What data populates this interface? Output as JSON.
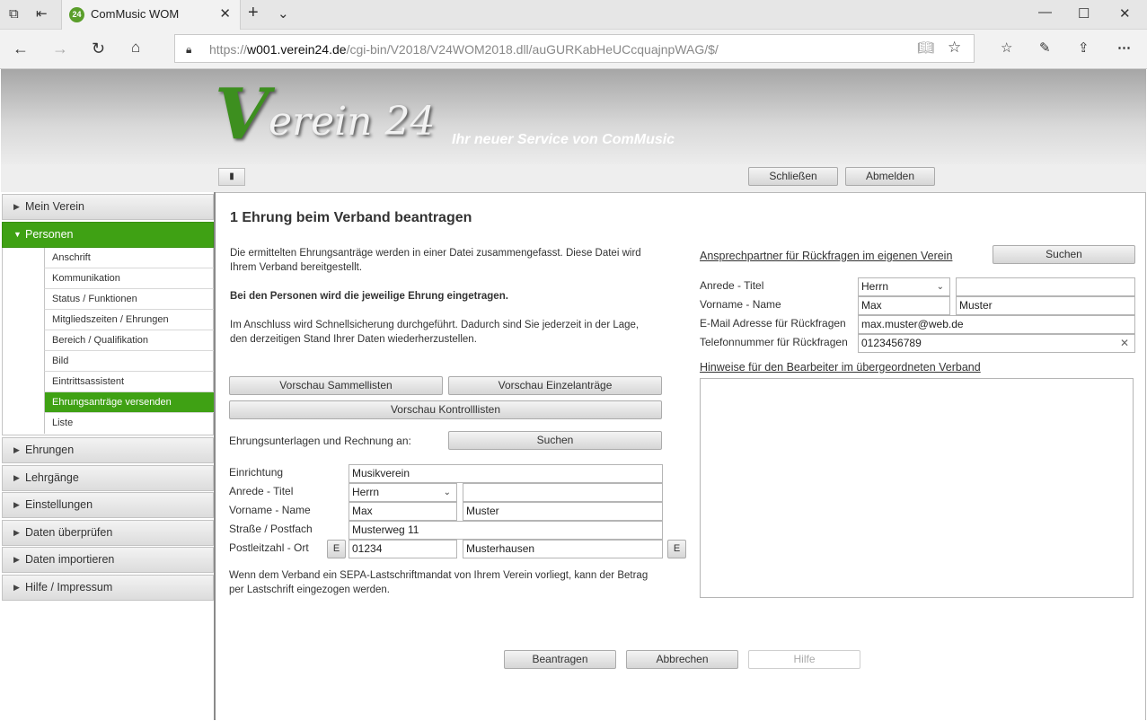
{
  "browser": {
    "tab_title": "ComMusic WOM",
    "tab_favicon_text": "24",
    "url_prefix": "https://",
    "url_host": "w001.verein24.de",
    "url_path": "/cgi-bin/V2018/V24WOM2018.dll/auGURKabHeUCcquajnpWAG/$/"
  },
  "header": {
    "logo_first": "V",
    "logo_rest": "erein 24",
    "slogan": "Ihr neuer Service von ComMusic"
  },
  "toolbar": {
    "menu_glyph": "▮",
    "close_label": "Schließen",
    "logout_label": "Abmelden"
  },
  "nav": {
    "mein_verein": "Mein Verein",
    "personen": "Personen",
    "sub": {
      "anschrift": "Anschrift",
      "kommunikation": "Kommunikation",
      "status": "Status / Funktionen",
      "mitgliedszeiten": "Mitgliedszeiten / Ehrungen",
      "bereich": "Bereich / Qualifikation",
      "bild": "Bild",
      "eintritt": "Eintrittsassistent",
      "ehrungsantraege": "Ehrungsanträge versenden",
      "liste": "Liste"
    },
    "ehrungen": "Ehrungen",
    "lehrgaenge": "Lehrgänge",
    "einstellungen": "Einstellungen",
    "daten_pruefen": "Daten überprüfen",
    "daten_importieren": "Daten importieren",
    "hilfe": "Hilfe / Impressum"
  },
  "main": {
    "title": "1 Ehrung beim Verband beantragen",
    "para1_line1": "Die ermittelten Ehrungsanträge werden in einer Datei zusammengefasst. Diese Datei wird",
    "para1_line2": "Ihrem Verband bereitgestellt.",
    "para2": "Bei den Personen wird die jeweilige Ehrung eingetragen.",
    "para3_line1": "Im Anschluss wird Schnellsicherung durchgeführt. Dadurch sind Sie jederzeit in der Lage,",
    "para3_line2": "den derzeitigen Stand Ihrer Daten wiederherzustellen.",
    "btn_vorschau_sammel": "Vorschau Sammellisten",
    "btn_vorschau_einzel": "Vorschau Einzelanträge",
    "btn_vorschau_kontroll": "Vorschau Kontrolllisten",
    "unterlagen_label": "Ehrungsunterlagen und Rechnung an:",
    "btn_suchen": "Suchen",
    "form": {
      "einrichtung_label": "Einrichtung",
      "einrichtung_value": "Musikverein",
      "anrede_label": "Anrede - Titel",
      "anrede_value": "Herrn",
      "titel_value": "",
      "name_label": "Vorname - Name",
      "vorname_value": "Max",
      "nachname_value": "Muster",
      "strasse_label": "Straße / Postfach",
      "strasse_value": "Musterweg 11",
      "plz_label": "Postleitzahl - Ort",
      "plz_value": "01234",
      "ort_value": "Musterhausen",
      "e_label": "E"
    },
    "sepa_line1": "Wenn dem Verband ein SEPA-Lastschriftmandat von Ihrem Verein vorliegt, kann der Betrag",
    "sepa_line2": "per Lastschrift eingezogen werden.",
    "right": {
      "ansprech_title": "Ansprechpartner für Rückfragen im eigenen Verein",
      "btn_suchen": "Suchen",
      "anrede_label": "Anrede - Titel",
      "anrede_value": "Herrn",
      "titel_value": "",
      "name_label": "Vorname - Name",
      "vorname_value": "Max",
      "nachname_value": "Muster",
      "email_label": "E-Mail Adresse für Rückfragen",
      "email_value": "max.muster@web.de",
      "telefon_label": "Telefonnummer für Rückfragen",
      "telefon_value": "0123456789",
      "hinweise_title": "Hinweise für den Bearbeiter im übergeordneten Verband",
      "hinweise_value": ""
    },
    "btn_beantragen": "Beantragen",
    "btn_abbrechen": "Abbrechen",
    "btn_hilfe": "Hilfe"
  }
}
